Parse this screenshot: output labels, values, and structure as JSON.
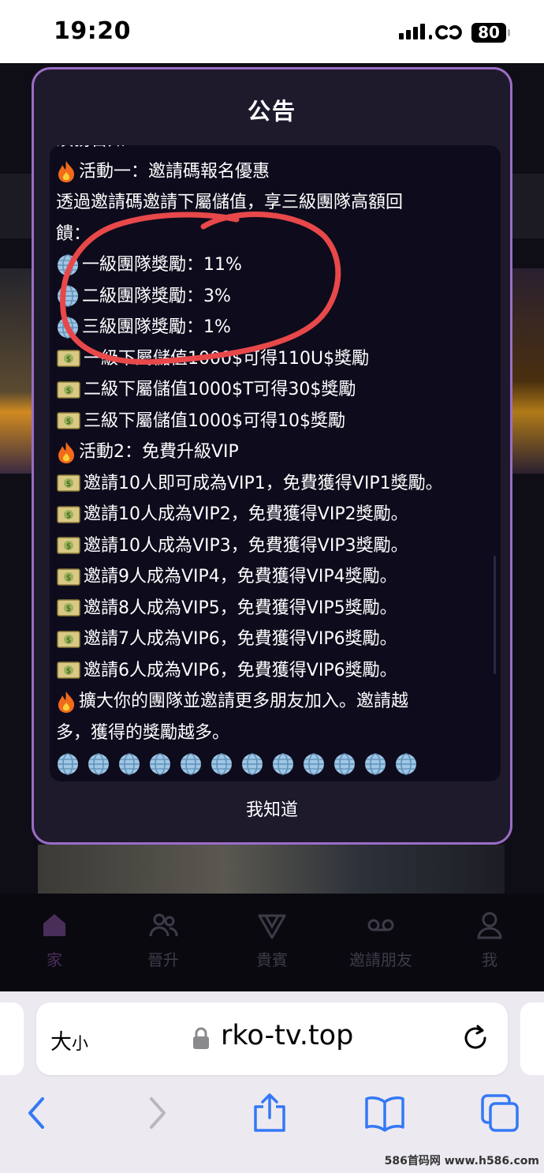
{
  "status_bar": {
    "time": "19:20",
    "battery": "80"
  },
  "modal": {
    "title": "公告",
    "lines": [
      {
        "icon": "none",
        "text": "須務告知："
      },
      {
        "icon": "fire",
        "text": "活動一：邀請碼報名優惠"
      },
      {
        "icon": "none",
        "text": "透過邀請碼邀請下屬儲值，享三級團隊高額回"
      },
      {
        "icon": "none",
        "text": "饋："
      },
      {
        "icon": "globe",
        "text": "一級團隊獎勵：11%"
      },
      {
        "icon": "globe",
        "text": "二級團隊獎勵：3%"
      },
      {
        "icon": "globe",
        "text": "三級團隊獎勵：1%"
      },
      {
        "icon": "money",
        "text": "一級下屬儲值1000$可得110U$獎勵"
      },
      {
        "icon": "money",
        "text": "二級下屬儲值1000$T可得30$獎勵"
      },
      {
        "icon": "money",
        "text": "三級下屬儲值1000$可得10$獎勵"
      },
      {
        "icon": "fire",
        "text": "活動2：免費升級VIP"
      },
      {
        "icon": "money",
        "text": "邀請10人即可成為VIP1，免費獲得VIP1獎勵。"
      },
      {
        "icon": "money",
        "text": "邀請10人成為VIP2，免費獲得VIP2獎勵。"
      },
      {
        "icon": "money",
        "text": "邀請10人成為VIP3，免費獲得VIP3獎勵。"
      },
      {
        "icon": "money",
        "text": "邀請9人成為VIP4，免費獲得VIP4獎勵。"
      },
      {
        "icon": "money",
        "text": "邀請8人成為VIP5，免費獲得VIP5獎勵。"
      },
      {
        "icon": "money",
        "text": "邀請7人成為VIP6，免費獲得VIP6獎勵。"
      },
      {
        "icon": "money",
        "text": "邀請6人成為VIP6，免費獲得VIP6獎勵。"
      },
      {
        "icon": "fire",
        "text": "擴大你的團隊並邀請更多朋友加入。邀請越"
      },
      {
        "icon": "none",
        "text": "多，獲得的獎勵越多。"
      }
    ],
    "globe_row_count": 12,
    "confirm_label": "我知道"
  },
  "tab_bar": {
    "tabs": [
      {
        "label": "家",
        "icon": "home-icon",
        "active": true
      },
      {
        "label": "晉升",
        "icon": "users-icon",
        "active": false
      },
      {
        "label": "貴賓",
        "icon": "vip-icon",
        "active": false
      },
      {
        "label": "邀請朋友",
        "icon": "voicemail-icon",
        "active": false
      },
      {
        "label": "我",
        "icon": "user-icon",
        "active": false
      }
    ]
  },
  "browser": {
    "text_size_label": "大",
    "text_size_small": "小",
    "domain": "rko-tv.top"
  },
  "watermark": "586首码网 www.h586.com",
  "colors": {
    "modal_border": "#9b6cc8",
    "annotation": "#e8484a",
    "safari_blue": "#3478f6"
  }
}
